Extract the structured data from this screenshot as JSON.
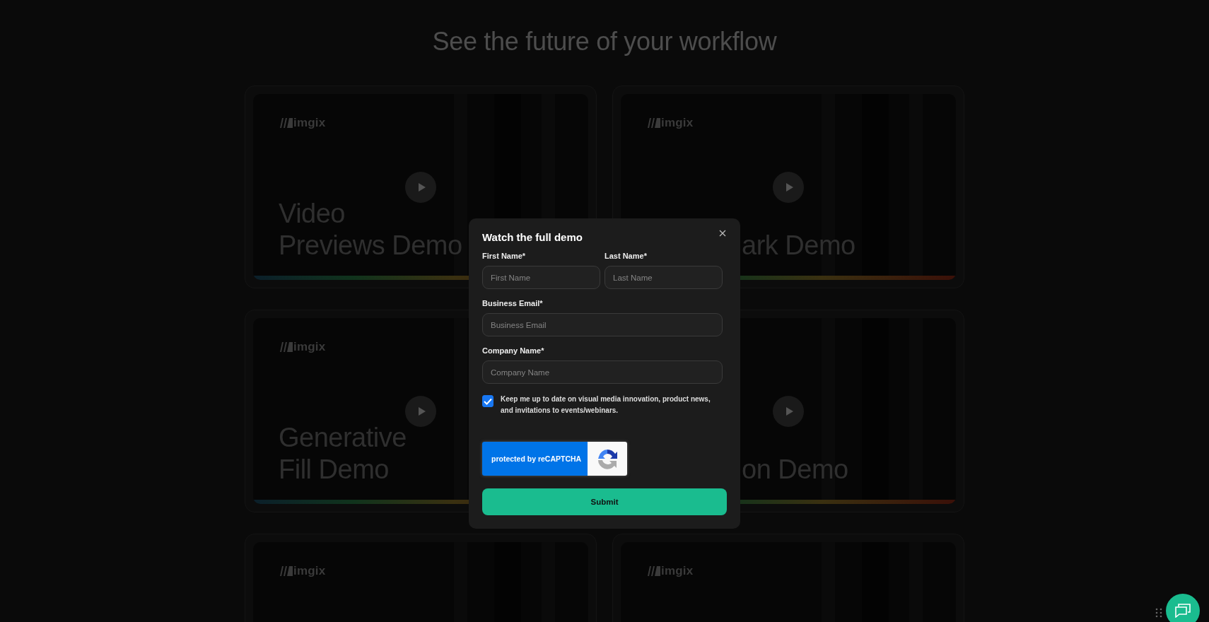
{
  "page": {
    "heading": "See the future of your workflow"
  },
  "cards": [
    {
      "logo": "imgix",
      "play": true,
      "title_lines": [
        {
          "text": "Video",
          "cut": false
        },
        {
          "text": "Previews Demo",
          "cut": false
        }
      ]
    },
    {
      "logo": "imgix",
      "play": true,
      "title_lines": [
        {
          "text": "ark Demo",
          "cut": true
        }
      ]
    },
    {
      "logo": "imgix",
      "play": true,
      "title_lines": [
        {
          "text": "Generative",
          "cut": false
        },
        {
          "text": "Fill Demo",
          "cut": false
        }
      ]
    },
    {
      "play": true,
      "title_lines": [
        {
          "text": "on Demo",
          "cut": true
        }
      ]
    },
    {
      "logo": "imgix",
      "play": false
    },
    {
      "logo": "imgix",
      "play": false
    }
  ],
  "dialog": {
    "title": "Watch the full demo",
    "fields": [
      {
        "label": "First Name*",
        "placeholder": "First Name",
        "half": true
      },
      {
        "label": "Last Name*",
        "placeholder": "Last Name",
        "half": true
      },
      {
        "label": "Business Email*",
        "placeholder": "Business Email",
        "half": false
      },
      {
        "label": "Company Name*",
        "placeholder": "Company Name",
        "half": false
      }
    ],
    "consent": {
      "checked": true,
      "text": "Keep me up to date on visual media innovation, product news, and invitations to events/webinars."
    },
    "recaptcha": "protected by reCAPTCHA",
    "submit": "Submit"
  }
}
